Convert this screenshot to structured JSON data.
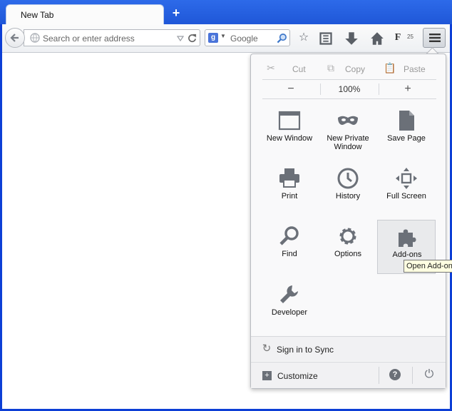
{
  "tabs": [
    {
      "title": "New Tab"
    }
  ],
  "urlbar": {
    "placeholder": "Search or enter address"
  },
  "searchbar": {
    "engine": "Google",
    "engine_letter": "g"
  },
  "toolbar": {
    "badge_count": "25"
  },
  "menu": {
    "edit": {
      "cut": "Cut",
      "copy": "Copy",
      "paste": "Paste"
    },
    "zoom": {
      "minus": "−",
      "level": "100%",
      "plus": "+"
    },
    "items": [
      {
        "label": "New Window",
        "icon": "new-window-icon"
      },
      {
        "label": "New Private\nWindow",
        "icon": "private-mask-icon"
      },
      {
        "label": "Save Page",
        "icon": "save-page-icon"
      },
      {
        "label": "Print",
        "icon": "printer-icon"
      },
      {
        "label": "History",
        "icon": "clock-icon"
      },
      {
        "label": "Full Screen",
        "icon": "fullscreen-icon"
      },
      {
        "label": "Find",
        "icon": "magnifier-icon"
      },
      {
        "label": "Options",
        "icon": "gear-icon"
      },
      {
        "label": "Add-ons",
        "icon": "puzzle-icon"
      },
      {
        "label": "Developer",
        "icon": "wrench-icon"
      }
    ],
    "sync": "Sign in to Sync",
    "customize": "Customize"
  },
  "tooltip": "Open Add-ons",
  "colors": {
    "titlebar": "#1f57d8",
    "panel": "#f9f9fa",
    "icon": "#6b7078"
  }
}
